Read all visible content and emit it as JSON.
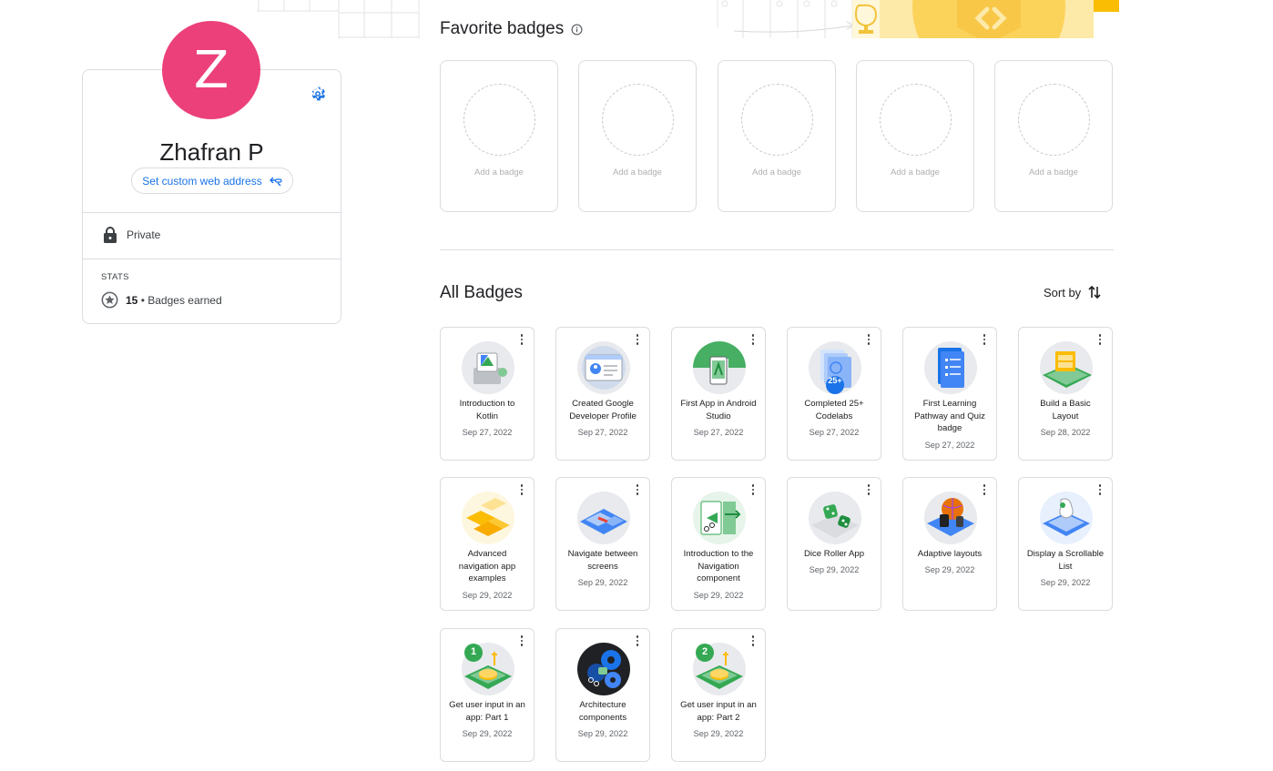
{
  "profile": {
    "avatar_initial": "Z",
    "name": "Zhafran P",
    "custom_url_label": "Set custom web address",
    "privacy": "Private",
    "stats_label": "STATS",
    "badge_count": "15",
    "badges_earned_label": "• Badges earned",
    "avatar_color": "#ec407a",
    "accent_color": "#1a73e8"
  },
  "favorites": {
    "title": "Favorite badges",
    "slots": [
      {
        "label": "Add a badge"
      },
      {
        "label": "Add a badge"
      },
      {
        "label": "Add a badge"
      },
      {
        "label": "Add a badge"
      },
      {
        "label": "Add a badge"
      }
    ]
  },
  "all_badges": {
    "title": "All Badges",
    "sort_label": "Sort by",
    "badges": [
      {
        "name": "Introduction to Kotlin",
        "date": "Sep 27, 2022",
        "icon": "kotlin-badge-icon"
      },
      {
        "name": "Created Google Developer Profile",
        "date": "Sep 27, 2022",
        "icon": "developer-profile-badge-icon"
      },
      {
        "name": "First App in Android Studio",
        "date": "Sep 27, 2022",
        "icon": "android-studio-badge-icon"
      },
      {
        "name": "Completed 25+ Codelabs",
        "date": "Sep 27, 2022",
        "icon": "codelabs-badge-icon",
        "overlay": "25+"
      },
      {
        "name": "First Learning Pathway and Quiz badge",
        "date": "Sep 27, 2022",
        "icon": "pathway-quiz-badge-icon"
      },
      {
        "name": "Build a Basic Layout",
        "date": "Sep 28, 2022",
        "icon": "basic-layout-badge-icon"
      },
      {
        "name": "Advanced navigation app examples",
        "date": "Sep 29, 2022",
        "icon": "advanced-navigation-badge-icon"
      },
      {
        "name": "Navigate between screens",
        "date": "Sep 29, 2022",
        "icon": "navigate-screens-badge-icon"
      },
      {
        "name": "Introduction to the Navigation component",
        "date": "Sep 29, 2022",
        "icon": "navigation-component-badge-icon"
      },
      {
        "name": "Dice Roller App",
        "date": "Sep 29, 2022",
        "icon": "dice-roller-badge-icon"
      },
      {
        "name": "Adaptive layouts",
        "date": "Sep 29, 2022",
        "icon": "adaptive-layouts-badge-icon"
      },
      {
        "name": "Display a Scrollable List",
        "date": "Sep 29, 2022",
        "icon": "scrollable-list-badge-icon"
      },
      {
        "name": "Get user input in an app: Part 1",
        "date": "Sep 29, 2022",
        "icon": "user-input-part1-badge-icon",
        "overlay": "1"
      },
      {
        "name": "Architecture components",
        "date": "Sep 29, 2022",
        "icon": "architecture-components-badge-icon"
      },
      {
        "name": "Get user input in an app: Part 2",
        "date": "Sep 29, 2022",
        "icon": "user-input-part2-badge-icon",
        "overlay": "2"
      }
    ]
  }
}
